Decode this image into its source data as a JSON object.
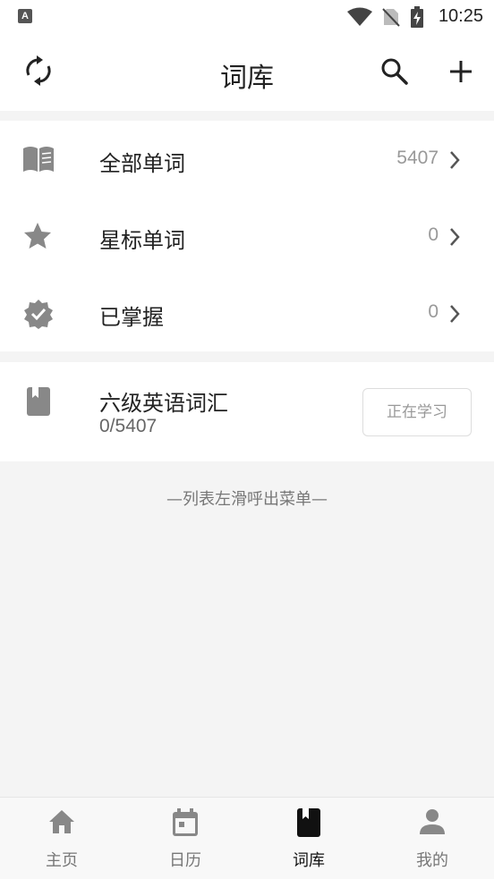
{
  "status_bar": {
    "app_badge": "A",
    "time": "10:25",
    "icons": [
      "wifi-icon",
      "no-sim-icon",
      "battery-charging-icon"
    ]
  },
  "header": {
    "title": "词库",
    "left_icon": "sync-icon",
    "right_icons": [
      "search-icon",
      "add-icon"
    ]
  },
  "word_groups": [
    {
      "icon": "book-open-icon",
      "label": "全部单词",
      "count": "5407"
    },
    {
      "icon": "star-icon",
      "label": "星标单词",
      "count": "0"
    },
    {
      "icon": "verified-check-icon",
      "label": "已掌握",
      "count": "0"
    }
  ],
  "book": {
    "icon": "book-icon",
    "name": "六级英语词汇",
    "progress_text": "0/5407",
    "button_label": "正在学习"
  },
  "hint": "—列表左滑呼出菜单—",
  "bottom_nav": {
    "active_index": 2,
    "items": [
      {
        "label": "主页",
        "icon": "home-icon"
      },
      {
        "label": "日历",
        "icon": "calendar-icon"
      },
      {
        "label": "词库",
        "icon": "book-icon"
      },
      {
        "label": "我的",
        "icon": "person-icon"
      }
    ]
  },
  "colors": {
    "icon_gray": "#888888",
    "active_black": "#111111",
    "background": "#f4f4f4"
  }
}
